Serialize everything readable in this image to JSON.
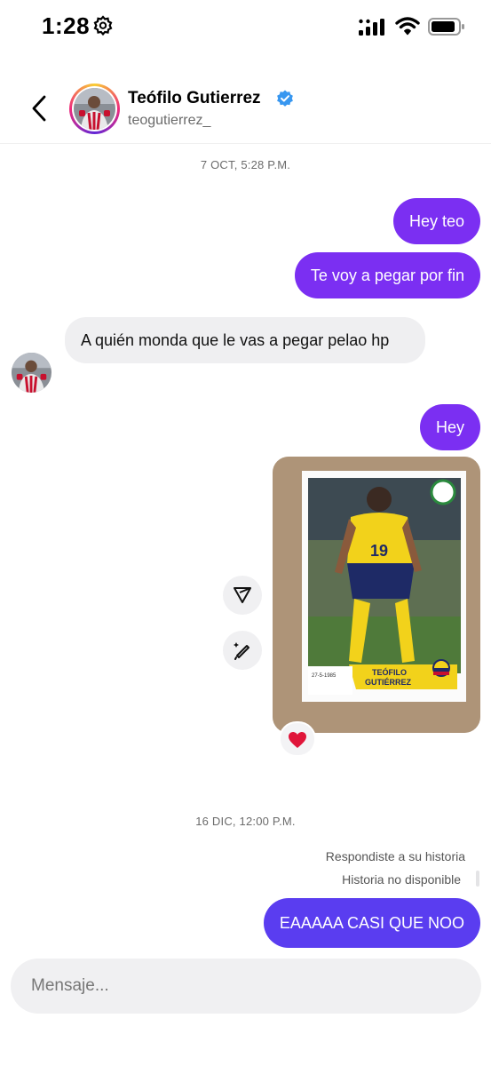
{
  "status_bar": {
    "time": "1:28"
  },
  "header": {
    "name": "Teófilo Gutierrez",
    "username": "teogutierrez_"
  },
  "timestamps": [
    "7 OCT, 5:28 P.M.",
    "16 DIC, 12:00 P.M."
  ],
  "messages": [
    {
      "text": "Hey teo"
    },
    {
      "text": "Te voy a pegar por fin"
    },
    {
      "text": "A quién monda que le vas a pegar pelao hp"
    },
    {
      "text": "Hey"
    },
    {
      "text": "EAAAAA CASI QUE NOO"
    }
  ],
  "photo_card": {
    "name_line1": "TEÓFILO",
    "name_line2": "GUTIÉRREZ",
    "number": "19",
    "date": "27-5-1985"
  },
  "reaction": {
    "icon": "heart-icon",
    "color": "#e0153a"
  },
  "story_notes": [
    "Respondiste a su historia",
    "Historia no disponible"
  ],
  "composer": {
    "placeholder": "Mensaje..."
  },
  "colors": {
    "outgoing": "#7b2ff2",
    "outgoing_latest": "#5a3df0",
    "incoming": "#efeff1",
    "verified": "#3897f0"
  }
}
